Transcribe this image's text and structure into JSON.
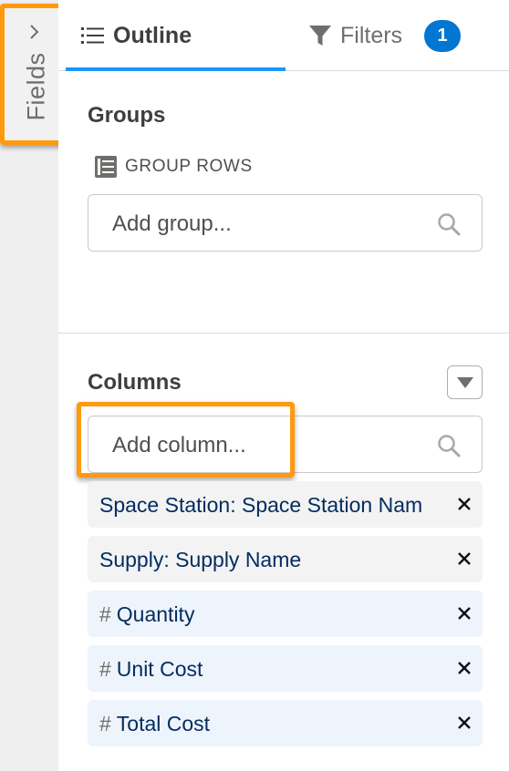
{
  "sidebar": {
    "label": "Fields",
    "toggle_icon": "chevron-right-icon"
  },
  "tabs": [
    {
      "label": "Outline",
      "icon": "list-icon",
      "active": true
    },
    {
      "label": "Filters",
      "icon": "filter-icon",
      "badge": "1"
    }
  ],
  "groups": {
    "title": "Groups",
    "subheading": "GROUP ROWS",
    "subheading_icon": "table-rows-icon",
    "search_placeholder": "Add group..."
  },
  "columns": {
    "title": "Columns",
    "search_placeholder": "Add column...",
    "items": [
      {
        "label": "Space Station: Space Station Nam",
        "type": "lookup"
      },
      {
        "label": "Supply: Supply Name",
        "type": "lookup"
      },
      {
        "label": "Quantity",
        "type": "number",
        "prefix": "#"
      },
      {
        "label": "Unit Cost",
        "type": "number",
        "prefix": "#"
      },
      {
        "label": "Total Cost",
        "type": "number",
        "prefix": "#"
      }
    ]
  },
  "colors": {
    "accent": "#1b96ff",
    "badge": "#0176d3",
    "highlight": "#ff9a0e",
    "column_text": "#032d60"
  }
}
